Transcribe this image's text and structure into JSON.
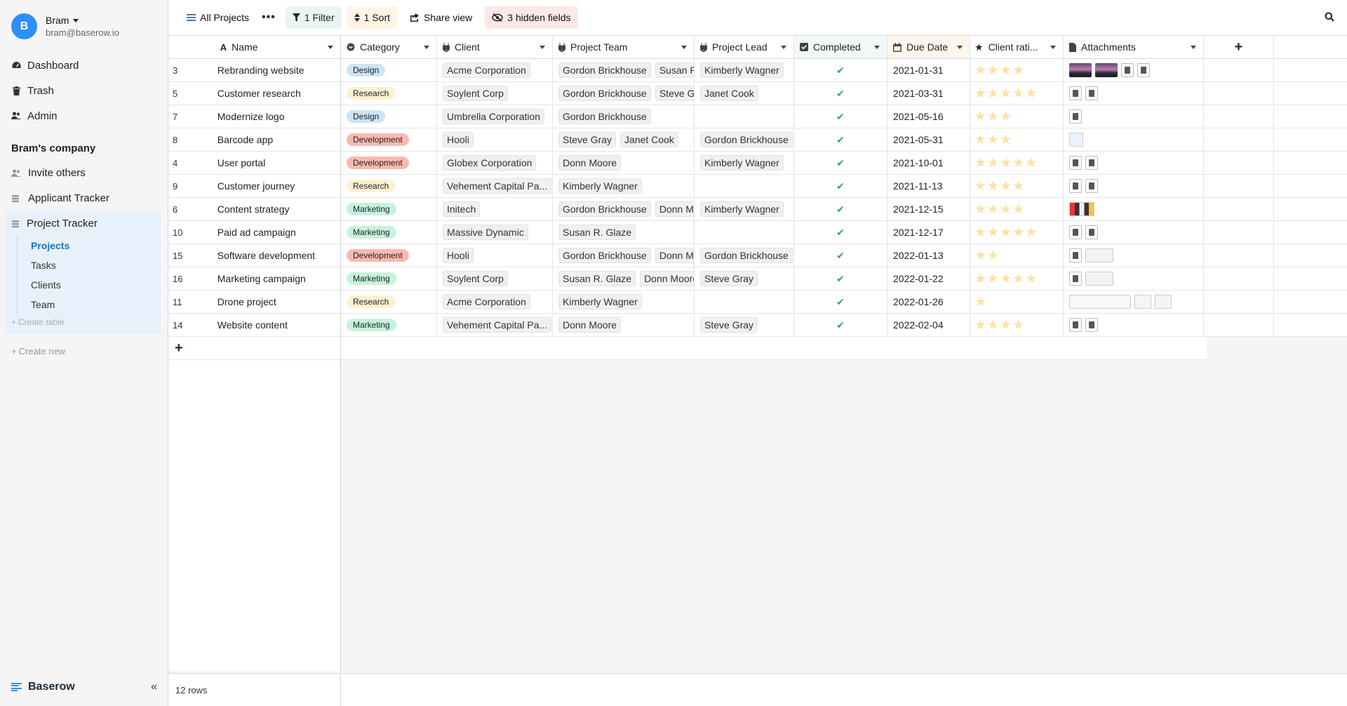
{
  "user": {
    "initial": "B",
    "name": "Bram",
    "email": "bram@baserow.io"
  },
  "nav": [
    {
      "label": "Dashboard",
      "icon": "tachometer-icon"
    },
    {
      "label": "Trash",
      "icon": "trash-icon"
    },
    {
      "label": "Admin",
      "icon": "users-icon"
    }
  ],
  "workspace": {
    "name": "Bram's company"
  },
  "workspace_items": [
    {
      "label": "Invite others",
      "icon": "user-friends-icon"
    },
    {
      "label": "Applicant Tracker",
      "icon": "database-icon"
    }
  ],
  "active_db": {
    "label": "Project Tracker",
    "tables": [
      "Projects",
      "Tasks",
      "Clients",
      "Team"
    ],
    "selected": "Projects",
    "create_table": "Create table"
  },
  "create_new": "Create new",
  "brand": "Baserow",
  "header": {
    "view_name": "All Projects",
    "filter": "1 Filter",
    "sort": "1 Sort",
    "share": "Share view",
    "hidden": "3 hidden fields"
  },
  "columns": {
    "name": "Name",
    "category": "Category",
    "client": "Client",
    "team": "Project Team",
    "lead": "Project Lead",
    "completed": "Completed",
    "due": "Due Date",
    "rating": "Client rati...",
    "attachments": "Attachments"
  },
  "category_colors": {
    "Design": "#cce4f7",
    "Research": "#fff0d2",
    "Development": "#fbb8b2",
    "Marketing": "#c6f3dd"
  },
  "rows": [
    {
      "id": "3",
      "name": "Rebranding website",
      "category": "Design",
      "client": "Acme Corporation",
      "team": [
        "Gordon Brickhouse",
        "Susan R."
      ],
      "lead": "Kimberly Wagner",
      "due": "2021-01-31",
      "rating": 4,
      "att": [
        "img",
        "img",
        "doc",
        "doc"
      ]
    },
    {
      "id": "5",
      "name": "Customer research",
      "category": "Research",
      "client": "Soylent Corp",
      "team": [
        "Gordon Brickhouse",
        "Steve Gra"
      ],
      "lead": "Janet Cook",
      "due": "2021-03-31",
      "rating": 5,
      "att": [
        "doc",
        "doc"
      ]
    },
    {
      "id": "7",
      "name": "Modernize logo",
      "category": "Design",
      "client": "Umbrella Corporation",
      "team": [
        "Gordon Brickhouse"
      ],
      "lead": "",
      "due": "2021-05-16",
      "rating": 3,
      "att": [
        "doc"
      ]
    },
    {
      "id": "8",
      "name": "Barcode app",
      "category": "Development",
      "client": "Hooli",
      "team": [
        "Steve Gray",
        "Janet Cook"
      ],
      "lead": "Gordon Brickhouse",
      "due": "2021-05-31",
      "rating": 3,
      "att": [
        "blue"
      ]
    },
    {
      "id": "4",
      "name": "User portal",
      "category": "Development",
      "client": "Globex Corporation",
      "team": [
        "Donn Moore"
      ],
      "lead": "Kimberly Wagner",
      "due": "2021-10-01",
      "rating": 5,
      "att": [
        "doc",
        "doc"
      ]
    },
    {
      "id": "9",
      "name": "Customer journey",
      "category": "Research",
      "client": "Vehement Capital Pa...",
      "team": [
        "Kimberly Wagner"
      ],
      "lead": "",
      "due": "2021-11-13",
      "rating": 4,
      "att": [
        "doc",
        "doc"
      ]
    },
    {
      "id": "6",
      "name": "Content strategy",
      "category": "Marketing",
      "client": "Initech",
      "team": [
        "Gordon Brickhouse",
        "Donn Mc"
      ],
      "lead": "Kimberly Wagner",
      "due": "2021-12-15",
      "rating": 4,
      "att": [
        "color"
      ]
    },
    {
      "id": "10",
      "name": "Paid ad campaign",
      "category": "Marketing",
      "client": "Massive Dynamic",
      "team": [
        "Susan R. Glaze"
      ],
      "lead": "",
      "due": "2021-12-17",
      "rating": 5,
      "att": [
        "doc",
        "doc"
      ]
    },
    {
      "id": "15",
      "name": "Software development",
      "category": "Development",
      "client": "Hooli",
      "team": [
        "Gordon Brickhouse",
        "Donn Mc"
      ],
      "lead": "Gordon Brickhouse",
      "due": "2022-01-13",
      "rating": 2,
      "att": [
        "doc",
        "wide"
      ]
    },
    {
      "id": "16",
      "name": "Marketing campaign",
      "category": "Marketing",
      "client": "Soylent Corp",
      "team": [
        "Susan R. Glaze",
        "Donn Moore"
      ],
      "lead": "Steve Gray",
      "due": "2022-01-22",
      "rating": 5,
      "att": [
        "doc",
        "wide"
      ]
    },
    {
      "id": "11",
      "name": "Drone project",
      "category": "Research",
      "client": "Acme Corporation",
      "team": [
        "Kimberly Wagner"
      ],
      "lead": "",
      "due": "2022-01-26",
      "rating": 1,
      "att": [
        "shot",
        "blank",
        "blank"
      ]
    },
    {
      "id": "14",
      "name": "Website content",
      "category": "Marketing",
      "client": "Vehement Capital Pa...",
      "team": [
        "Donn Moore"
      ],
      "lead": "Steve Gray",
      "due": "2022-02-04",
      "rating": 4,
      "att": [
        "doc",
        "doc"
      ]
    }
  ],
  "footer": {
    "count": "12 rows"
  }
}
